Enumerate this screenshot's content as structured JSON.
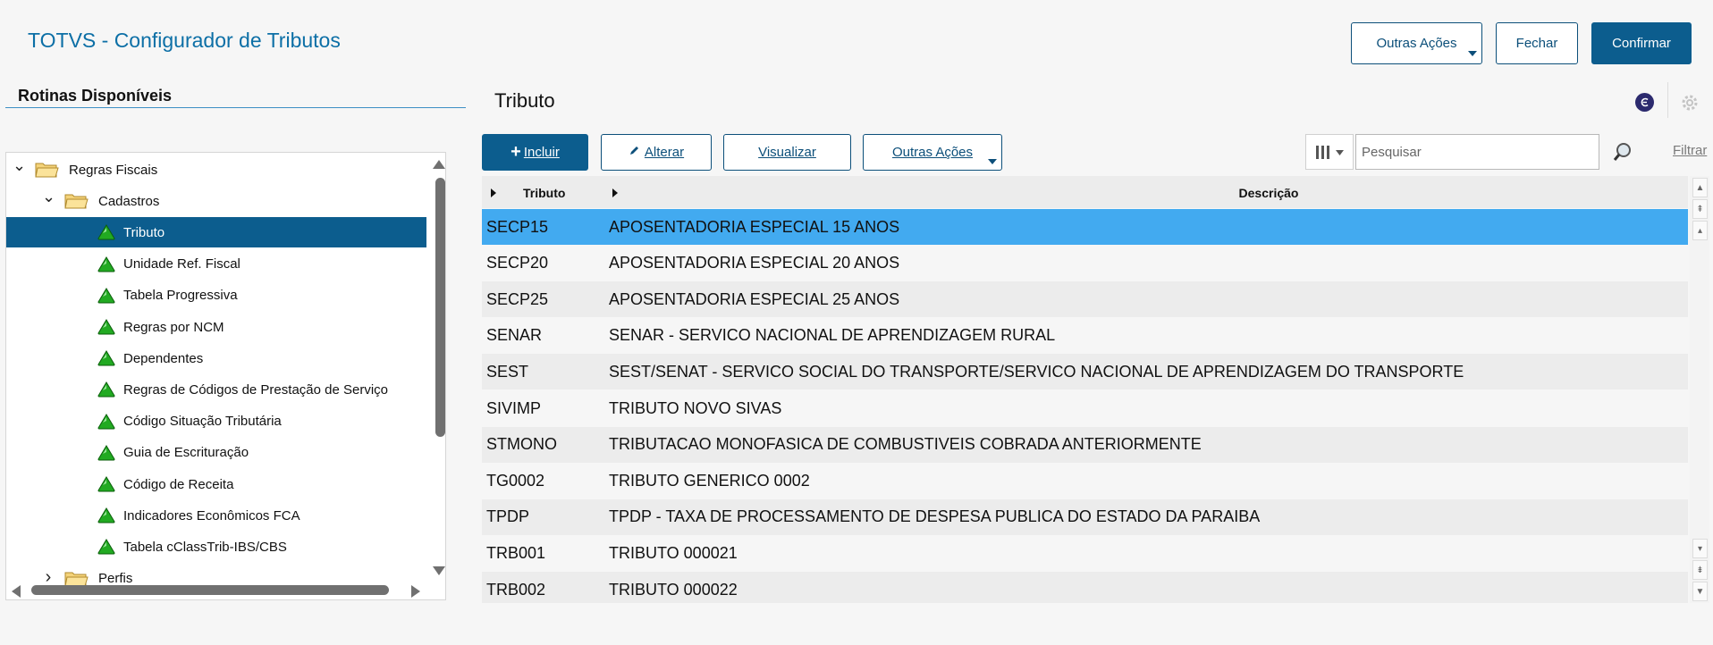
{
  "app": {
    "title": "TOTVS - Configurador de Tributos"
  },
  "header_buttons": {
    "outras_acoes": "Outras Ações",
    "fechar": "Fechar",
    "confirmar": "Confirmar"
  },
  "left_panel": {
    "heading": "Rotinas Disponíveis",
    "tree": [
      {
        "label": "Regras Fiscais",
        "level": 0,
        "kind": "folder",
        "toggle": "expanded"
      },
      {
        "label": "Cadastros",
        "level": 1,
        "kind": "folder",
        "toggle": "expanded"
      },
      {
        "label": "Tributo",
        "level": 2,
        "kind": "item",
        "selected": true
      },
      {
        "label": "Unidade Ref. Fiscal",
        "level": 2,
        "kind": "item"
      },
      {
        "label": "Tabela Progressiva",
        "level": 2,
        "kind": "item"
      },
      {
        "label": "Regras por NCM",
        "level": 2,
        "kind": "item"
      },
      {
        "label": "Dependentes",
        "level": 2,
        "kind": "item"
      },
      {
        "label": "Regras de Códigos de Prestação de Serviço",
        "level": 2,
        "kind": "item"
      },
      {
        "label": "Código Situação Tributária",
        "level": 2,
        "kind": "item"
      },
      {
        "label": "Guia de Escrituração",
        "level": 2,
        "kind": "item"
      },
      {
        "label": "Código de Receita",
        "level": 2,
        "kind": "item"
      },
      {
        "label": "Indicadores Econômicos FCA",
        "level": 2,
        "kind": "item"
      },
      {
        "label": "Tabela cClassTrib-IBS/CBS",
        "level": 2,
        "kind": "item"
      },
      {
        "label": "Perfis",
        "level": 1,
        "kind": "folder",
        "toggle": "collapsed"
      }
    ]
  },
  "right_panel": {
    "heading": "Tributo",
    "toolbar": {
      "incluir": "Incluir",
      "alterar": "Alterar",
      "visualizar": "Visualizar",
      "outras_acoes": "Outras Ações"
    },
    "search": {
      "placeholder": "Pesquisar"
    },
    "filter_label": "Filtrar",
    "grid": {
      "columns": [
        "Tributo",
        "Descrição"
      ],
      "rows": [
        {
          "code": "SECP15",
          "desc": "APOSENTADORIA ESPECIAL 15 ANOS",
          "selected": true
        },
        {
          "code": "SECP20",
          "desc": "APOSENTADORIA ESPECIAL 20 ANOS"
        },
        {
          "code": "SECP25",
          "desc": "APOSENTADORIA ESPECIAL 25 ANOS"
        },
        {
          "code": "SENAR",
          "desc": "SENAR - SERVICO NACIONAL DE APRENDIZAGEM RURAL"
        },
        {
          "code": "SEST",
          "desc": "SEST/SENAT - SERVICO SOCIAL DO TRANSPORTE/SERVICO NACIONAL DE APRENDIZAGEM DO TRANSPORTE"
        },
        {
          "code": "SIVIMP",
          "desc": "TRIBUTO NOVO SIVAS"
        },
        {
          "code": "STMONO",
          "desc": "TRIBUTACAO MONOFASICA DE COMBUSTIVEIS COBRADA ANTERIORMENTE"
        },
        {
          "code": "TG0002",
          "desc": "TRIBUTO GENERICO 0002"
        },
        {
          "code": "TPDP",
          "desc": "TPDP - TAXA DE PROCESSAMENTO DE DESPESA PUBLICA DO ESTADO DA PARAIBA"
        },
        {
          "code": "TRB001",
          "desc": "TRIBUTO 000021"
        },
        {
          "code": "TRB002",
          "desc": "TRIBUTO 000022"
        }
      ]
    }
  },
  "colors": {
    "brand": "#0c5d8e",
    "selected_row": "#42aaf0",
    "title": "#0c6fa6",
    "tree_icon": "#22aa22"
  }
}
